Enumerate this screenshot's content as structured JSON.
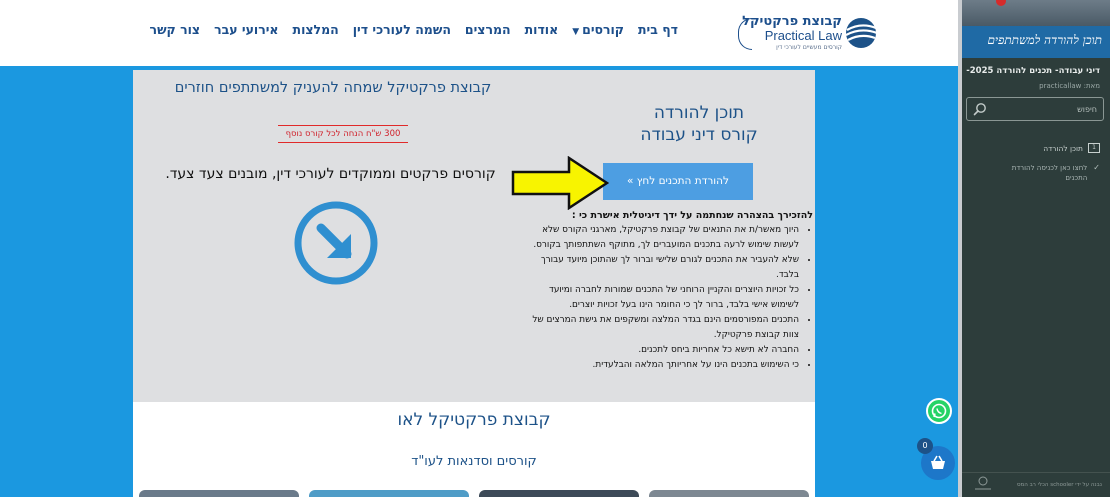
{
  "nav": {
    "items": [
      {
        "label": "דף בית"
      },
      {
        "label": "קורסים",
        "has_caret": true
      },
      {
        "label": "אודות"
      },
      {
        "label": "המרצים"
      },
      {
        "label": "השמה לעורכי דין"
      },
      {
        "label": "המלצות"
      },
      {
        "label": "אירועי עבר"
      },
      {
        "label": "צור קשר"
      }
    ]
  },
  "logo": {
    "hebrew": "קבוצת פרקטיקל",
    "english": "Practical Law",
    "subtitle": "קורסים מעשיים לעורכי דין"
  },
  "promo": {
    "headline": "קבוצת פרקטיקל שמחה להעניק למשתתפים חוזרים",
    "badge": "300 ש\"ח הנחה לכל קורס נוסף",
    "tagline": "קורסים פרקטים וממוקדים לעורכי דין, מובנים צעד צעד."
  },
  "download": {
    "title_line1": "תוכן להורדה",
    "title_line2": "קורס דיני עבודה",
    "button_label": "להורדת התכנים לחץ »"
  },
  "terms": {
    "heading": "להזכירך בהצהרה שנחתמה על ידך דיגיטלית אישרת כי :",
    "items": [
      "היוך מאשר/ת את התנאים של קבוצת פרקטיקל, מארגני הקורס שלא לעשות שימוש לרעה בתכנים המועברים לך, מתוקף השתתפותך בקורס.",
      "שלא להעביר את התכנים לגורם שלישי וברור לך שהתוכן מיועד עבורך בלבד.",
      "כל זכויות היוצרים והקניין הרוחני של התכנים שמורות לחברה ומיועד לשימוש אישי בלבד, ברור לך כי החומר הינו בעל זכויות יוצרים.",
      "התכנים המפורסמים הינם בגדר המלצה ומשקפים את גישת המרצים של צוות קבוצת פרקטיקל.",
      "החברה לא תישא כל אחריות ביחס לתכנים.",
      "כי השימוש בתכנים הינו על אחריותך המלאה והבלעדית."
    ]
  },
  "lower": {
    "title": "קבוצת פרקטיקל לאו",
    "subtitle": "קורסים וסדנאות לעו\"ד"
  },
  "cart": {
    "count": "0"
  },
  "sidebar": {
    "banner_text": "תוכן להורדה למשתתפים",
    "course_title": "דיני עבודה- תכנים להורדה 2025-",
    "author": "מאת: practicallaw",
    "search_placeholder": "חיפוש",
    "items": [
      {
        "label": "תוכן להורדה"
      },
      {
        "label": "לחצו כאן לכניסה להורדת התכנים"
      }
    ],
    "footer": "נבנה על ידי schooler הכלי רב המס"
  },
  "colors": {
    "brand_blue": "#1d5288",
    "band_blue": "#1b98e0",
    "panel_grey": "#dedfe1",
    "button_blue": "#4d9ee2",
    "arrow_yellow": "#f8f400",
    "badge_red": "#d0202a",
    "sidebar_dark": "#2d3d3b"
  }
}
